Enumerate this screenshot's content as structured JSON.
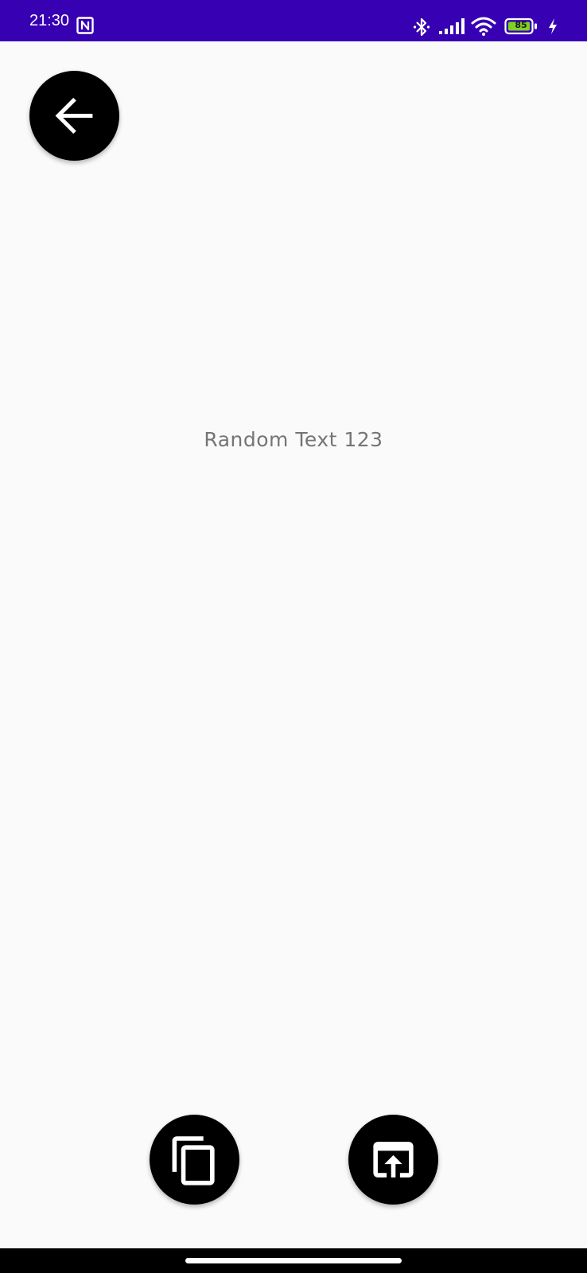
{
  "status_bar": {
    "time": "21:30",
    "battery_level": "85",
    "background_color": "#3700b3",
    "icons": [
      "nfc-icon",
      "bluetooth-icon",
      "signal-icon",
      "wifi-icon",
      "battery-icon",
      "charging-icon"
    ]
  },
  "toolbar": {
    "back_icon": "arrow-left-icon"
  },
  "content": {
    "text": "Random Text 123",
    "text_color": "#757575"
  },
  "actions": {
    "copy_icon": "copy-icon",
    "open_icon": "open-in-icon"
  },
  "colors": {
    "background": "#fafafa",
    "button": "#000000",
    "icon": "#ffffff"
  }
}
